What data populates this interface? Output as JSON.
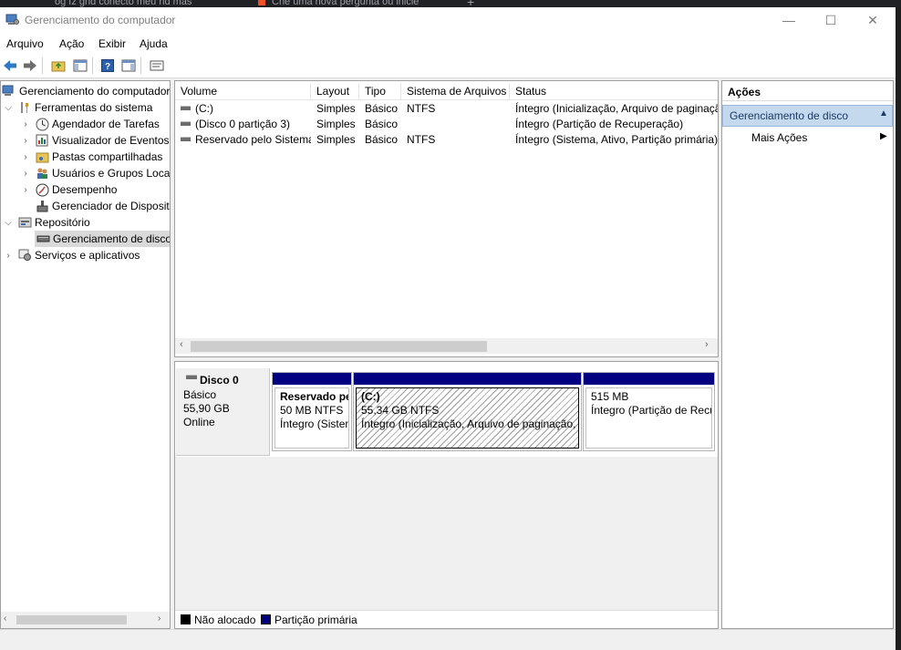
{
  "browser_tabs": [
    "og fz gnd conecto meu hd mas",
    "Crie uma nova pergunta ou inicie"
  ],
  "window": {
    "title": "Gerenciamento do computador",
    "minimize": "—",
    "maximize": "☐",
    "close": "✕"
  },
  "menu": [
    "Arquivo",
    "Ação",
    "Exibir",
    "Ajuda"
  ],
  "toolbar": [
    "back-icon",
    "forward-icon",
    "up-folder-icon",
    "show-hide-tree-icon",
    "help-icon",
    "show-hide-action-pane-icon",
    "properties-icon"
  ],
  "tree": {
    "root": "Gerenciamento do computador",
    "system_tools": "Ferramentas do sistema",
    "task_scheduler": "Agendador de Tarefas",
    "event_viewer": "Visualizador de Eventos",
    "shared_folders": "Pastas compartilhadas",
    "local_users": "Usuários e Grupos Locais",
    "performance": "Desempenho",
    "device_manager": "Gerenciador de Dispositivos",
    "storage": "Repositório",
    "disk_management": "Gerenciamento de disco",
    "services": "Serviços e aplicativos"
  },
  "volume_table": {
    "columns": [
      "Volume",
      "Layout",
      "Tipo",
      "Sistema de Arquivos",
      "Status"
    ],
    "rows": [
      {
        "volume": "(C:)",
        "layout": "Simples",
        "tipo": "Básico",
        "fs": "NTFS",
        "status": "Íntegro (Inicialização, Arquivo de paginação, Despejo de Memória, Partição primária)"
      },
      {
        "volume": "(Disco 0 partição 3)",
        "layout": "Simples",
        "tipo": "Básico",
        "fs": "",
        "status": "Íntegro (Partição de Recuperação)"
      },
      {
        "volume": "Reservado pelo Sistema",
        "layout": "Simples",
        "tipo": "Básico",
        "fs": "NTFS",
        "status": "Íntegro (Sistema, Ativo, Partição primária)"
      }
    ]
  },
  "disk": {
    "name": "Disco 0",
    "type": "Básico",
    "size": "55,90 GB",
    "state": "Online",
    "partitions": [
      {
        "name": "Reservado pelo Sistema",
        "size": "50 MB NTFS",
        "status": "Íntegro (Sistema, Ativo, Partição primária)"
      },
      {
        "name": "(C:)",
        "size": "55,34 GB NTFS",
        "status": "Íntegro (Inicialização, Arquivo de paginação, Despejo de Memória, Partição primária)"
      },
      {
        "name": "",
        "size": "515 MB",
        "status": "Íntegro (Partição de Recuperação)"
      }
    ]
  },
  "legend": [
    {
      "label": "Não alocado",
      "color": "#000000"
    },
    {
      "label": "Partição primária",
      "color": "#000080"
    }
  ],
  "actions": {
    "header": "Ações",
    "section": "Gerenciamento de disco",
    "more": "Mais Ações"
  }
}
